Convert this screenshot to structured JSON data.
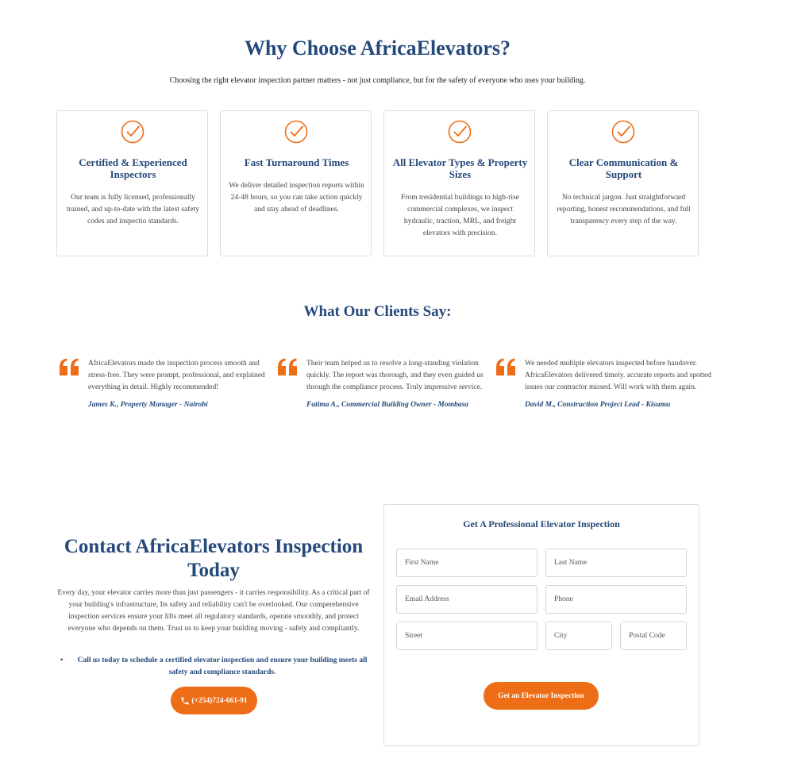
{
  "why": {
    "title": "Why Choose AfricaElevators?",
    "subtitle": "Choosing the right elevator inspection partner matters - not just compliance, but for the safety of everyone who uses your building.",
    "cards": [
      {
        "icon": "check-circle-icon",
        "title": "Certified & Experienced Inspectors",
        "text": "Our team is fully licensed, professionally trained, and up-to-date with the latest safety codes and inspectio standards."
      },
      {
        "icon": "check-circle-icon",
        "title": "Fast Turnaround Times",
        "text": "We deliver detailed inspection reports within 24-48 hours, so you can take action quickly and stay ahead of deadlines."
      },
      {
        "icon": "check-circle-icon",
        "title": "All Elevator Types & Property Sizes",
        "text": "From tresidential buildings to high-rise commercial complexes, we inspect hydraulic, traction, MRL, and freight elevators with precision."
      },
      {
        "icon": "check-circle-icon",
        "title": "Clear Communication & Support",
        "text": "No technical jargon. Just straightforward reporting, honest recommendations, and full transparency every step of the way."
      }
    ]
  },
  "clients": {
    "title": "What Our Clients Say:",
    "testimonials": [
      {
        "text": "AfricaElevators made the inspection process smooth and stress-free. They were prompt, professional, and explained everything in detail. Highly recommended!",
        "author": "James K., Property Manager - Nairobi"
      },
      {
        "text": "Their team helped us to resolve a long-standing violation quickly. The report was thorough, and they even guided us through the compliance process. Truly impressive service.",
        "author": "Fatima A., Commercial Building Owner - Mombasa"
      },
      {
        "text": "We needed multiple elevators inspected before handover. AfricaElevators delivered timely. accurate reports and spotted issues our contractor missed. Will work with them again.",
        "author": "David M., Construction Project Lead - Kisumu"
      }
    ]
  },
  "contact": {
    "title": "Contact AfricaElevators Inspection Today",
    "text": "Every day, your elevator carries more than just passengers - it carries responsibility. As a critical part of your building's infrastructure, Its safety and reliability can't be overlooked. Our comperehensive inspection services ensure your lifts meet all regulatory standards, operate smoothly, and protect everyone who depends on them. Trust us to keep your building moving - safely and compliantly.",
    "bullet": "Call us today to schedule a certified elevator inspection and ensure your building meets all safety and compliance standards.",
    "phone": "(+254)724-661-91"
  },
  "form": {
    "title": "Get A Professional Elevator Inspection",
    "first_name": "First Name",
    "last_name": "Last Name",
    "email": "Email Address",
    "phone": "Phone",
    "street": "Street",
    "city": "City",
    "postal": "Postal Code",
    "submit": "Get an Elevator Inspection"
  },
  "colors": {
    "brand_blue": "#24497a",
    "accent_orange": "#ee6d17"
  }
}
